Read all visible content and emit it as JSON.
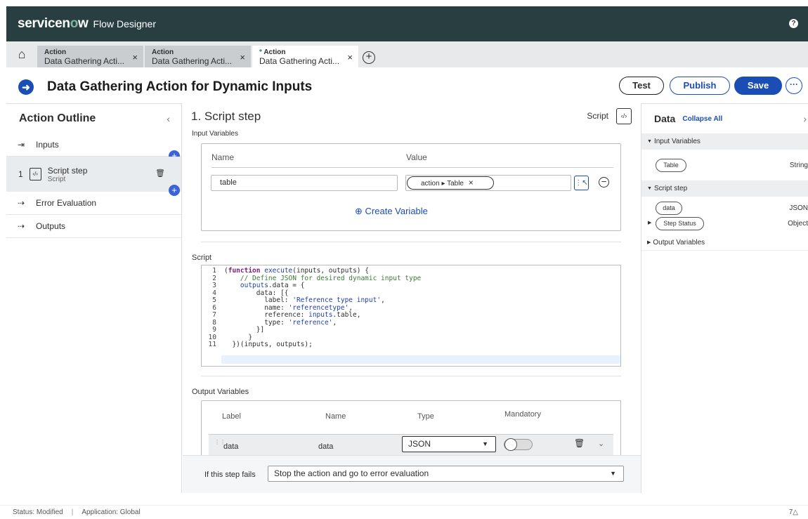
{
  "app": {
    "brand_prefix": "servicen",
    "brand_o": "o",
    "brand_suffix": "w",
    "subtitle": "Flow Designer",
    "help_label": "?"
  },
  "tabs": [
    {
      "type": "Action",
      "name": "Data Gathering Acti...",
      "modified": false
    },
    {
      "type": "Action",
      "name": "Data Gathering Acti...",
      "modified": false
    },
    {
      "type": "Action",
      "name": "Data Gathering Acti...",
      "modified": true,
      "modified_mark": "*"
    }
  ],
  "header": {
    "title": "Data Gathering Action for Dynamic Inputs",
    "test_label": "Test",
    "publish_label": "Publish",
    "save_label": "Save",
    "more_label": "···"
  },
  "outline": {
    "title": "Action Outline",
    "inputs_label": "Inputs",
    "step": {
      "number": "1",
      "name": "Script step",
      "type": "Script"
    },
    "error_label": "Error Evaluation",
    "outputs_label": "Outputs"
  },
  "step": {
    "title": "1. Script step",
    "type_label": "Script",
    "input_variables_label": "Input Variables",
    "name_col": "Name",
    "value_col": "Value",
    "input_name": "table",
    "input_pill": "action ▸ Table",
    "create_variable": "Create Variable",
    "script_label": "Script",
    "code_lines": [
      "(function execute(inputs, outputs) {",
      "    // Define JSON for desired dynamic input type",
      "    outputs.data = {",
      "        data: [{",
      "          label: 'Reference type input',",
      "          name: 'referencetype',",
      "          reference: inputs.table,",
      "          type: 'reference',",
      "        }]",
      "      }",
      "  })(inputs, outputs);"
    ],
    "output_variables_label": "Output Variables",
    "out_cols": {
      "label": "Label",
      "name": "Name",
      "type": "Type",
      "mandatory": "Mandatory"
    },
    "out_row": {
      "label": "data",
      "name": "data",
      "type": "JSON"
    },
    "fail_label": "If this step fails",
    "fail_value": "Stop the action and go to error evaluation"
  },
  "data_panel": {
    "title": "Data",
    "collapse": "Collapse All",
    "input_variables": "Input Variables",
    "table_pill": "Table",
    "table_type": "String",
    "script_step": "Script step",
    "data_pill": "data",
    "data_type": "JSON",
    "status_pill": "Step Status",
    "status_type": "Object",
    "output_variables": "Output Variables"
  },
  "status": {
    "modified": "Status: Modified",
    "application": "Application: Global",
    "right": "7△"
  }
}
